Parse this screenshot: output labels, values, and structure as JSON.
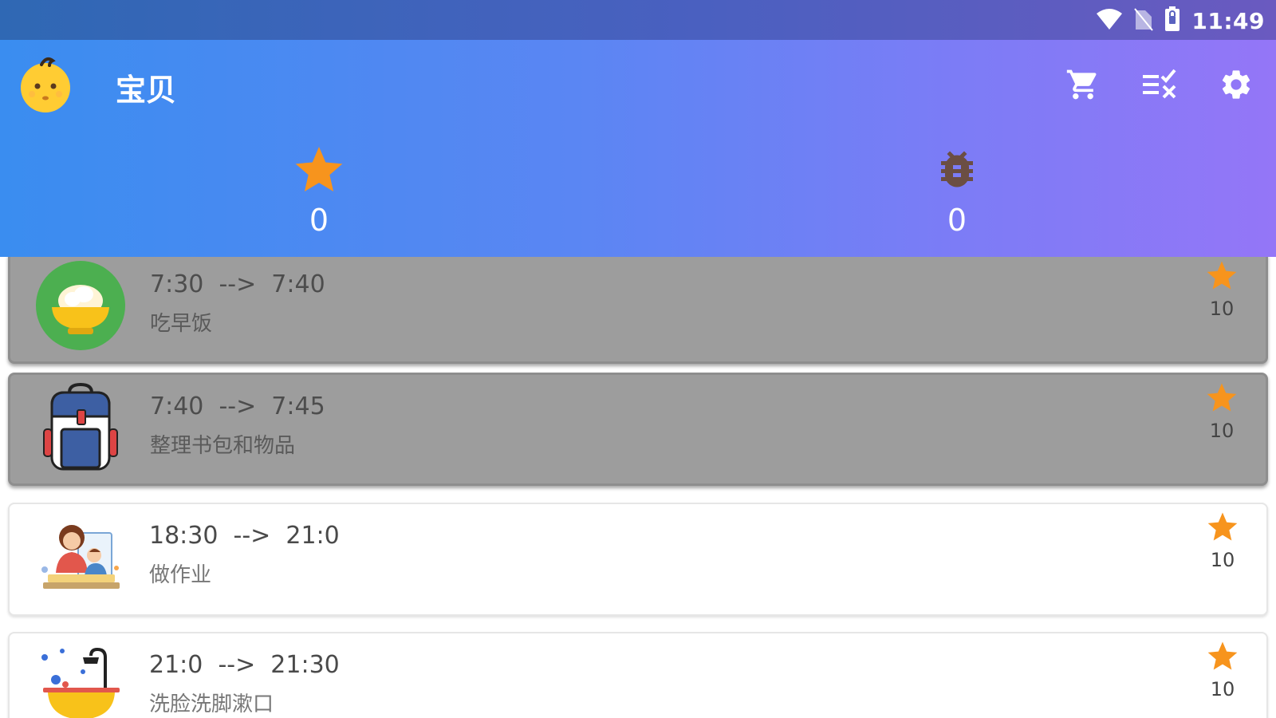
{
  "status_bar": {
    "time": "11:49",
    "icons": [
      "wifi-icon",
      "no-sim-icon",
      "battery-icon"
    ]
  },
  "header": {
    "avatar_icon": "baby-face-icon",
    "title": "宝贝",
    "actions": [
      {
        "name": "cart-button",
        "icon": "cart-icon"
      },
      {
        "name": "checklist-button",
        "icon": "checklist-clear-icon"
      },
      {
        "name": "settings-button",
        "icon": "gear-icon"
      }
    ],
    "stats": {
      "stars": {
        "icon": "star-icon",
        "value": "0"
      },
      "bugs": {
        "icon": "bug-icon",
        "value": "0"
      }
    }
  },
  "tasks": [
    {
      "time": "7:30  -->  7:40",
      "name": "吃早饭",
      "points": "10",
      "status": "done",
      "icon": "rice-bowl-icon"
    },
    {
      "time": "7:40  -->  7:45",
      "name": "整理书包和物品",
      "points": "10",
      "status": "done",
      "icon": "backpack-icon"
    },
    {
      "time": "18:30  -->  21:0",
      "name": "做作业",
      "points": "10",
      "status": "todo",
      "icon": "homework-icon"
    },
    {
      "time": "21:0  -->  21:30",
      "name": "洗脸洗脚漱口",
      "points": "10",
      "status": "todo",
      "icon": "bath-icon"
    }
  ],
  "colors": {
    "header_start": "#3a8df0",
    "header_end": "#9476f7",
    "star": "#f7941d",
    "bug": "#6b4e43",
    "done_card": "#9d9d9d"
  }
}
